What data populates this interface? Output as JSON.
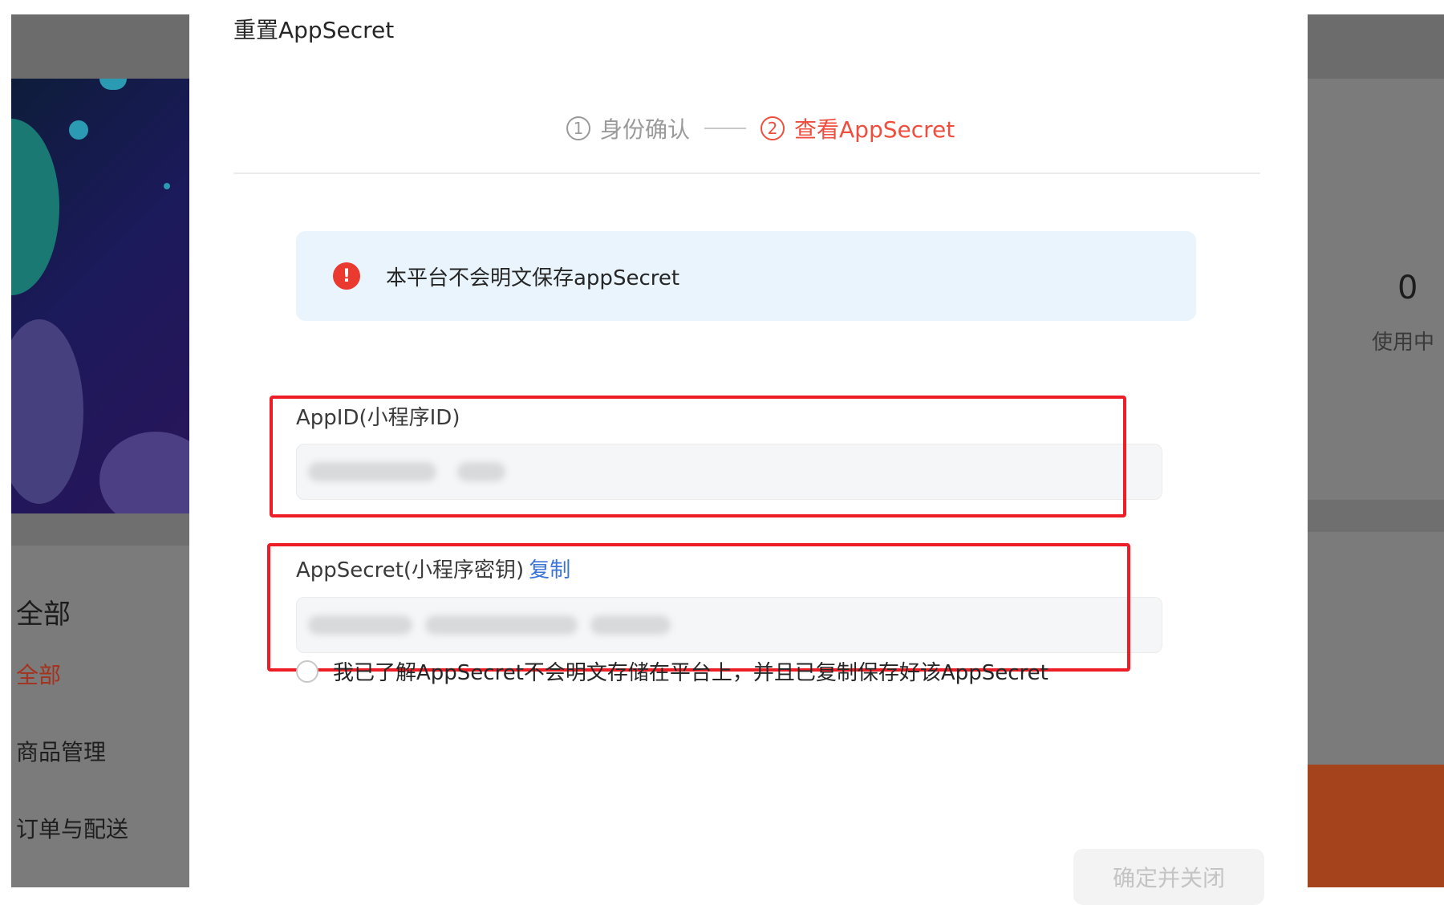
{
  "background_left": {
    "top_fragment": "",
    "nav_title": "全部",
    "nav_items": [
      {
        "label": "全部",
        "active": true
      },
      {
        "label": "商品管理",
        "active": false
      },
      {
        "label": "订单与配送",
        "active": false
      }
    ]
  },
  "background_right": {
    "count": "0",
    "count_label": "使用中"
  },
  "modal": {
    "title": "重置AppSecret",
    "steps": [
      {
        "num": "1",
        "label": "身份确认",
        "state": "done"
      },
      {
        "num": "2",
        "label": "查看AppSecret",
        "state": "current"
      }
    ],
    "alert": {
      "icon": "exclamation-icon",
      "text": "本平台不会明文保存appSecret",
      "color": "#ea3a2f",
      "background": "#e9f4fd"
    },
    "appid": {
      "label": "AppID(小程序ID)",
      "value_state": "blurred"
    },
    "appsecret": {
      "label": "AppSecret(小程序密钥)",
      "copy_label": "复制",
      "value_state": "blurred"
    },
    "agree": {
      "checked": false,
      "text": "我已了解AppSecret不会明文存储在平台上，并且已复制保存好该AppSecret"
    },
    "confirm_button": "确定并关闭",
    "accent_color": "#ef4e3f",
    "highlight_color": "#ee1c25"
  }
}
